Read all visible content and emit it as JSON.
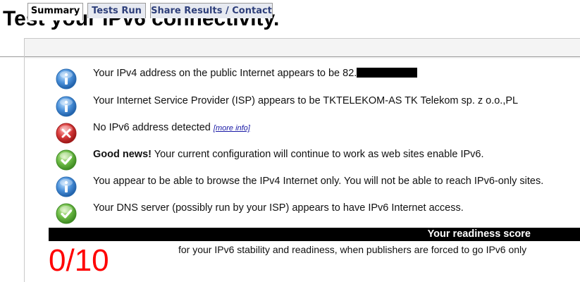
{
  "page": {
    "title": "Test your IPv6 connectivity."
  },
  "tabs": [
    {
      "label": "Summary",
      "active": true
    },
    {
      "label": "Tests Run",
      "active": false
    },
    {
      "label": "Share Results / Contact",
      "active": false
    }
  ],
  "results": [
    {
      "icon": "info-icon",
      "text_before": "Your IPv4 address on the public Internet appears to be 82.",
      "redacted": true
    },
    {
      "icon": "info-icon",
      "text": "Your Internet Service Provider (ISP) appears to be TKTELEKOM-AS TK Telekom sp. z o.o.,PL"
    },
    {
      "icon": "error-icon",
      "text": "No IPv6 address detected",
      "link": "[more info]"
    },
    {
      "icon": "check-icon",
      "bold": "Good news!",
      "text": " Your current configuration will continue to work as web sites enable IPv6."
    },
    {
      "icon": "info-icon",
      "text": "You appear to be able to browse the IPv4 Internet only. You will not be able to reach IPv6-only sites."
    },
    {
      "icon": "check-icon",
      "text": "Your DNS server (possibly run by your ISP) appears to have IPv6 Internet access."
    }
  ],
  "score": {
    "heading": "Your readiness score",
    "value": "0/10",
    "caption": "for your IPv6 stability and readiness, when publishers are forced to go IPv6 only"
  },
  "colors": {
    "info": "#3f86cc",
    "error": "#cc2a2a",
    "ok": "#5fae3a",
    "score_value": "#ff0000",
    "tab_text": "#2e3f7a"
  }
}
